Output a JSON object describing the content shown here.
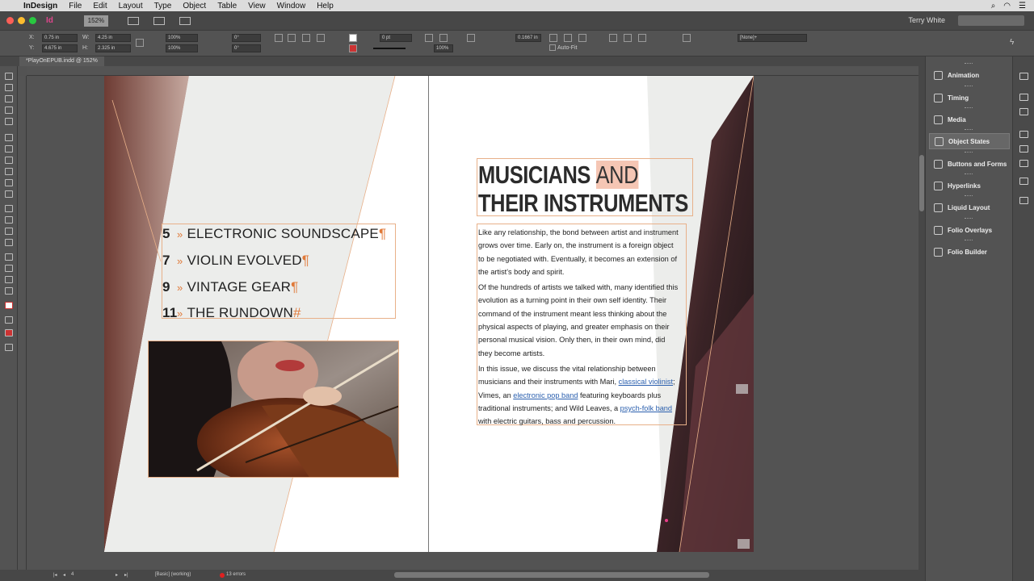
{
  "menubar": {
    "app_name": "InDesign",
    "menus": [
      "File",
      "Edit",
      "Layout",
      "Type",
      "Object",
      "Table",
      "View",
      "Window",
      "Help"
    ]
  },
  "appbar": {
    "logo": "Id",
    "zoom": "152%",
    "user": "Terry White"
  },
  "control": {
    "x_label": "X:",
    "x_value": "0.75 in",
    "y_label": "Y:",
    "y_value": "4.675 in",
    "w_label": "W:",
    "w_value": "4.25 in",
    "h_label": "H:",
    "h_value": "2.325 in",
    "scale_x": "100%",
    "scale_y": "100%",
    "rotate": "0°",
    "shear": "0°",
    "stroke": "0 pt",
    "fit_value": "0.1667 in",
    "opacity": "100%",
    "style": "[None]+",
    "autofit_label": "Auto-Fit"
  },
  "document": {
    "tab_title": "*PlayOnEPUB.indd @ 152%"
  },
  "toc": [
    {
      "num": "5",
      "arrow": "»",
      "label": "ELECTRONIC SOUNDSCAPE",
      "mark": "¶"
    },
    {
      "num": "7",
      "arrow": "»",
      "label": "VIOLIN EVOLVED",
      "mark": "¶"
    },
    {
      "num": "9",
      "arrow": "»",
      "label": "VINTAGE GEAR",
      "mark": "¶"
    },
    {
      "num": "11",
      "arrow": "»",
      "label": "THE RUNDOWN",
      "mark": "#"
    }
  ],
  "article": {
    "title_line1_a": "MUSICIANS",
    "title_line1_b": "AND",
    "title_line2": "THEIR INSTRUMENTS",
    "p1": "Like any relationship, the bond between artist and instrument grows over time. Early on, the instrument is a foreign object to be negotiated with. Eventually, it becomes an extension of the artist's body and spirit.",
    "p2": "Of the hundreds of artists we talked with, many identified this evolution as a turning point in their own self identity. Their command of the instrument meant less thinking about the physical aspects of playing, and greater emphasis on their personal musical vision. Only then, in their own mind, did they become artists.",
    "p3_a": "In this issue, we discuss the vital relationship between musicians and their instruments with Mari, ",
    "link1": "classical violinist",
    "p3_b": "; Vimes, an ",
    "link2": "electronic pop band",
    "p3_c": " featuring keyboards plus traditional instruments; and Wild Leaves, a ",
    "link3": "psych-folk band",
    "p3_d": " with electric guitars, bass and percussion."
  },
  "panel": {
    "items": [
      "Animation",
      "Timing",
      "Media",
      "Object States",
      "Buttons and Forms",
      "Hyperlinks",
      "Liquid Layout",
      "Folio Overlays",
      "Folio Builder"
    ]
  },
  "status": {
    "page": "4",
    "profile": "[Basic] (working)",
    "errors": "13 errors"
  },
  "colors": {
    "frame_orange": "#e8b089",
    "accent_orange": "#e07a3a",
    "link_blue": "#2a5fae",
    "highlight": "#f5c6b4"
  }
}
